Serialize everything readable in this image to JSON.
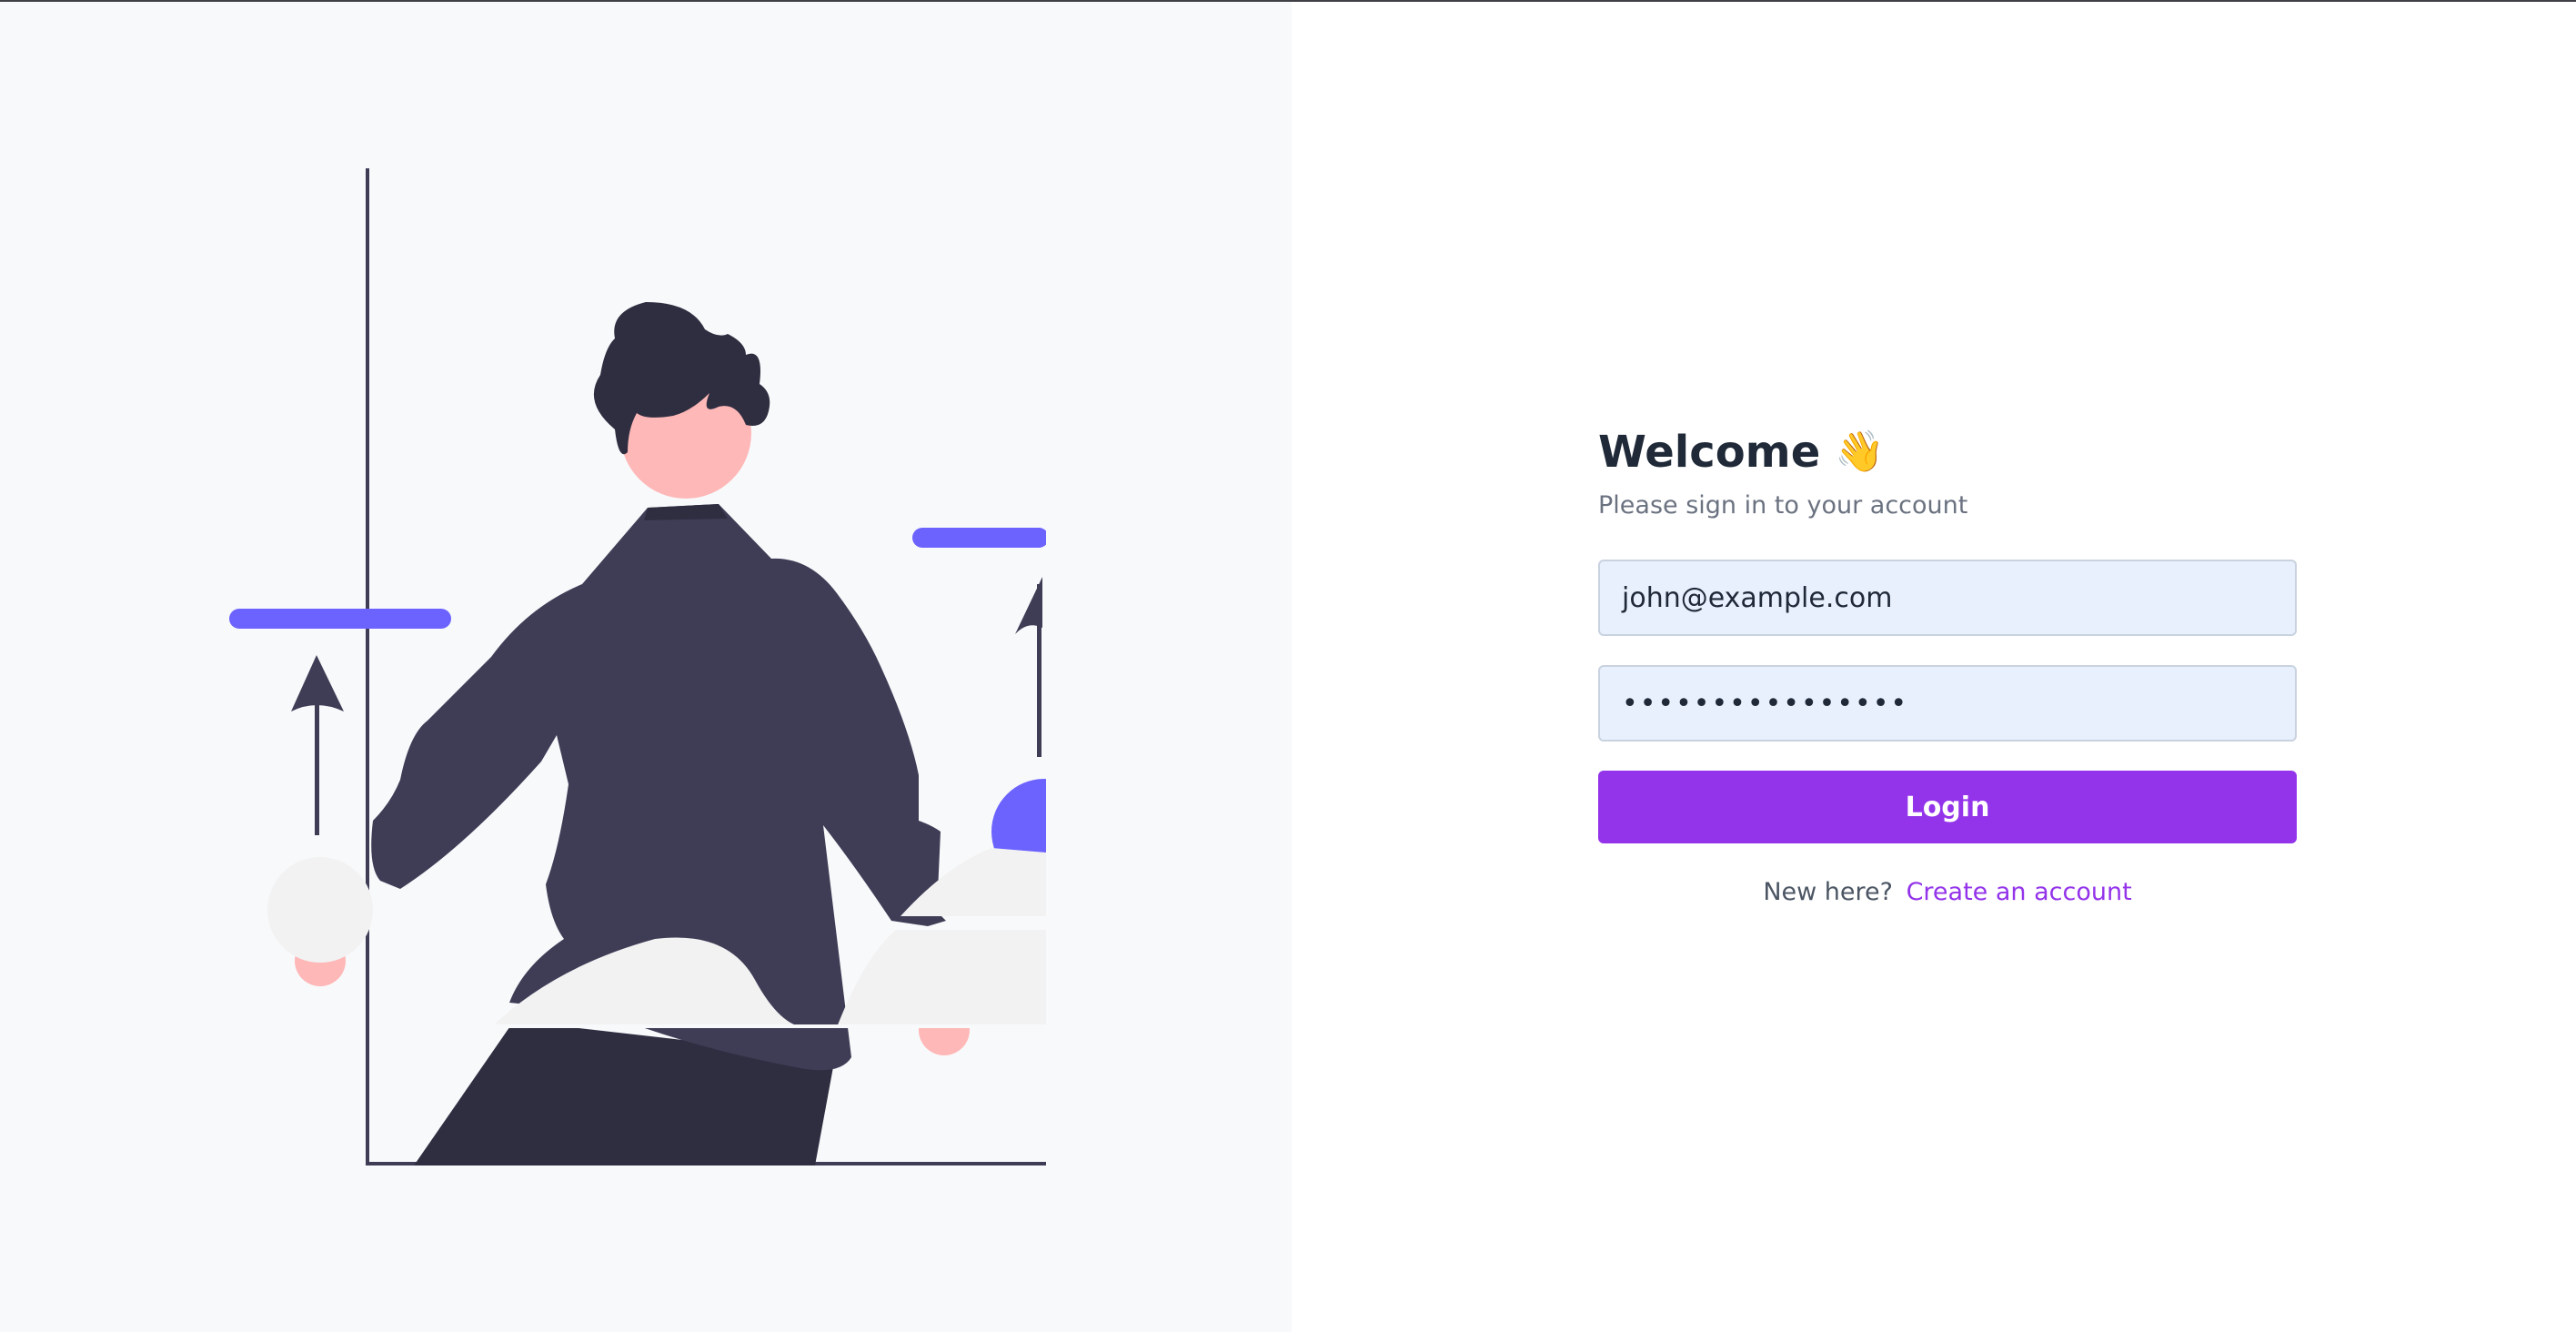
{
  "login": {
    "title": "Welcome",
    "wave_emoji": "👋",
    "subtitle": "Please sign in to your account",
    "email_value": "john@example.com",
    "password_masked": "••••••••••••••••",
    "login_button": "Login",
    "footer_prompt": "New here?",
    "create_account_link": "Create an account"
  },
  "colors": {
    "accent": "#9333ea",
    "illustration_accent": "#6c63ff",
    "panel_bg": "#f8f9fb"
  }
}
